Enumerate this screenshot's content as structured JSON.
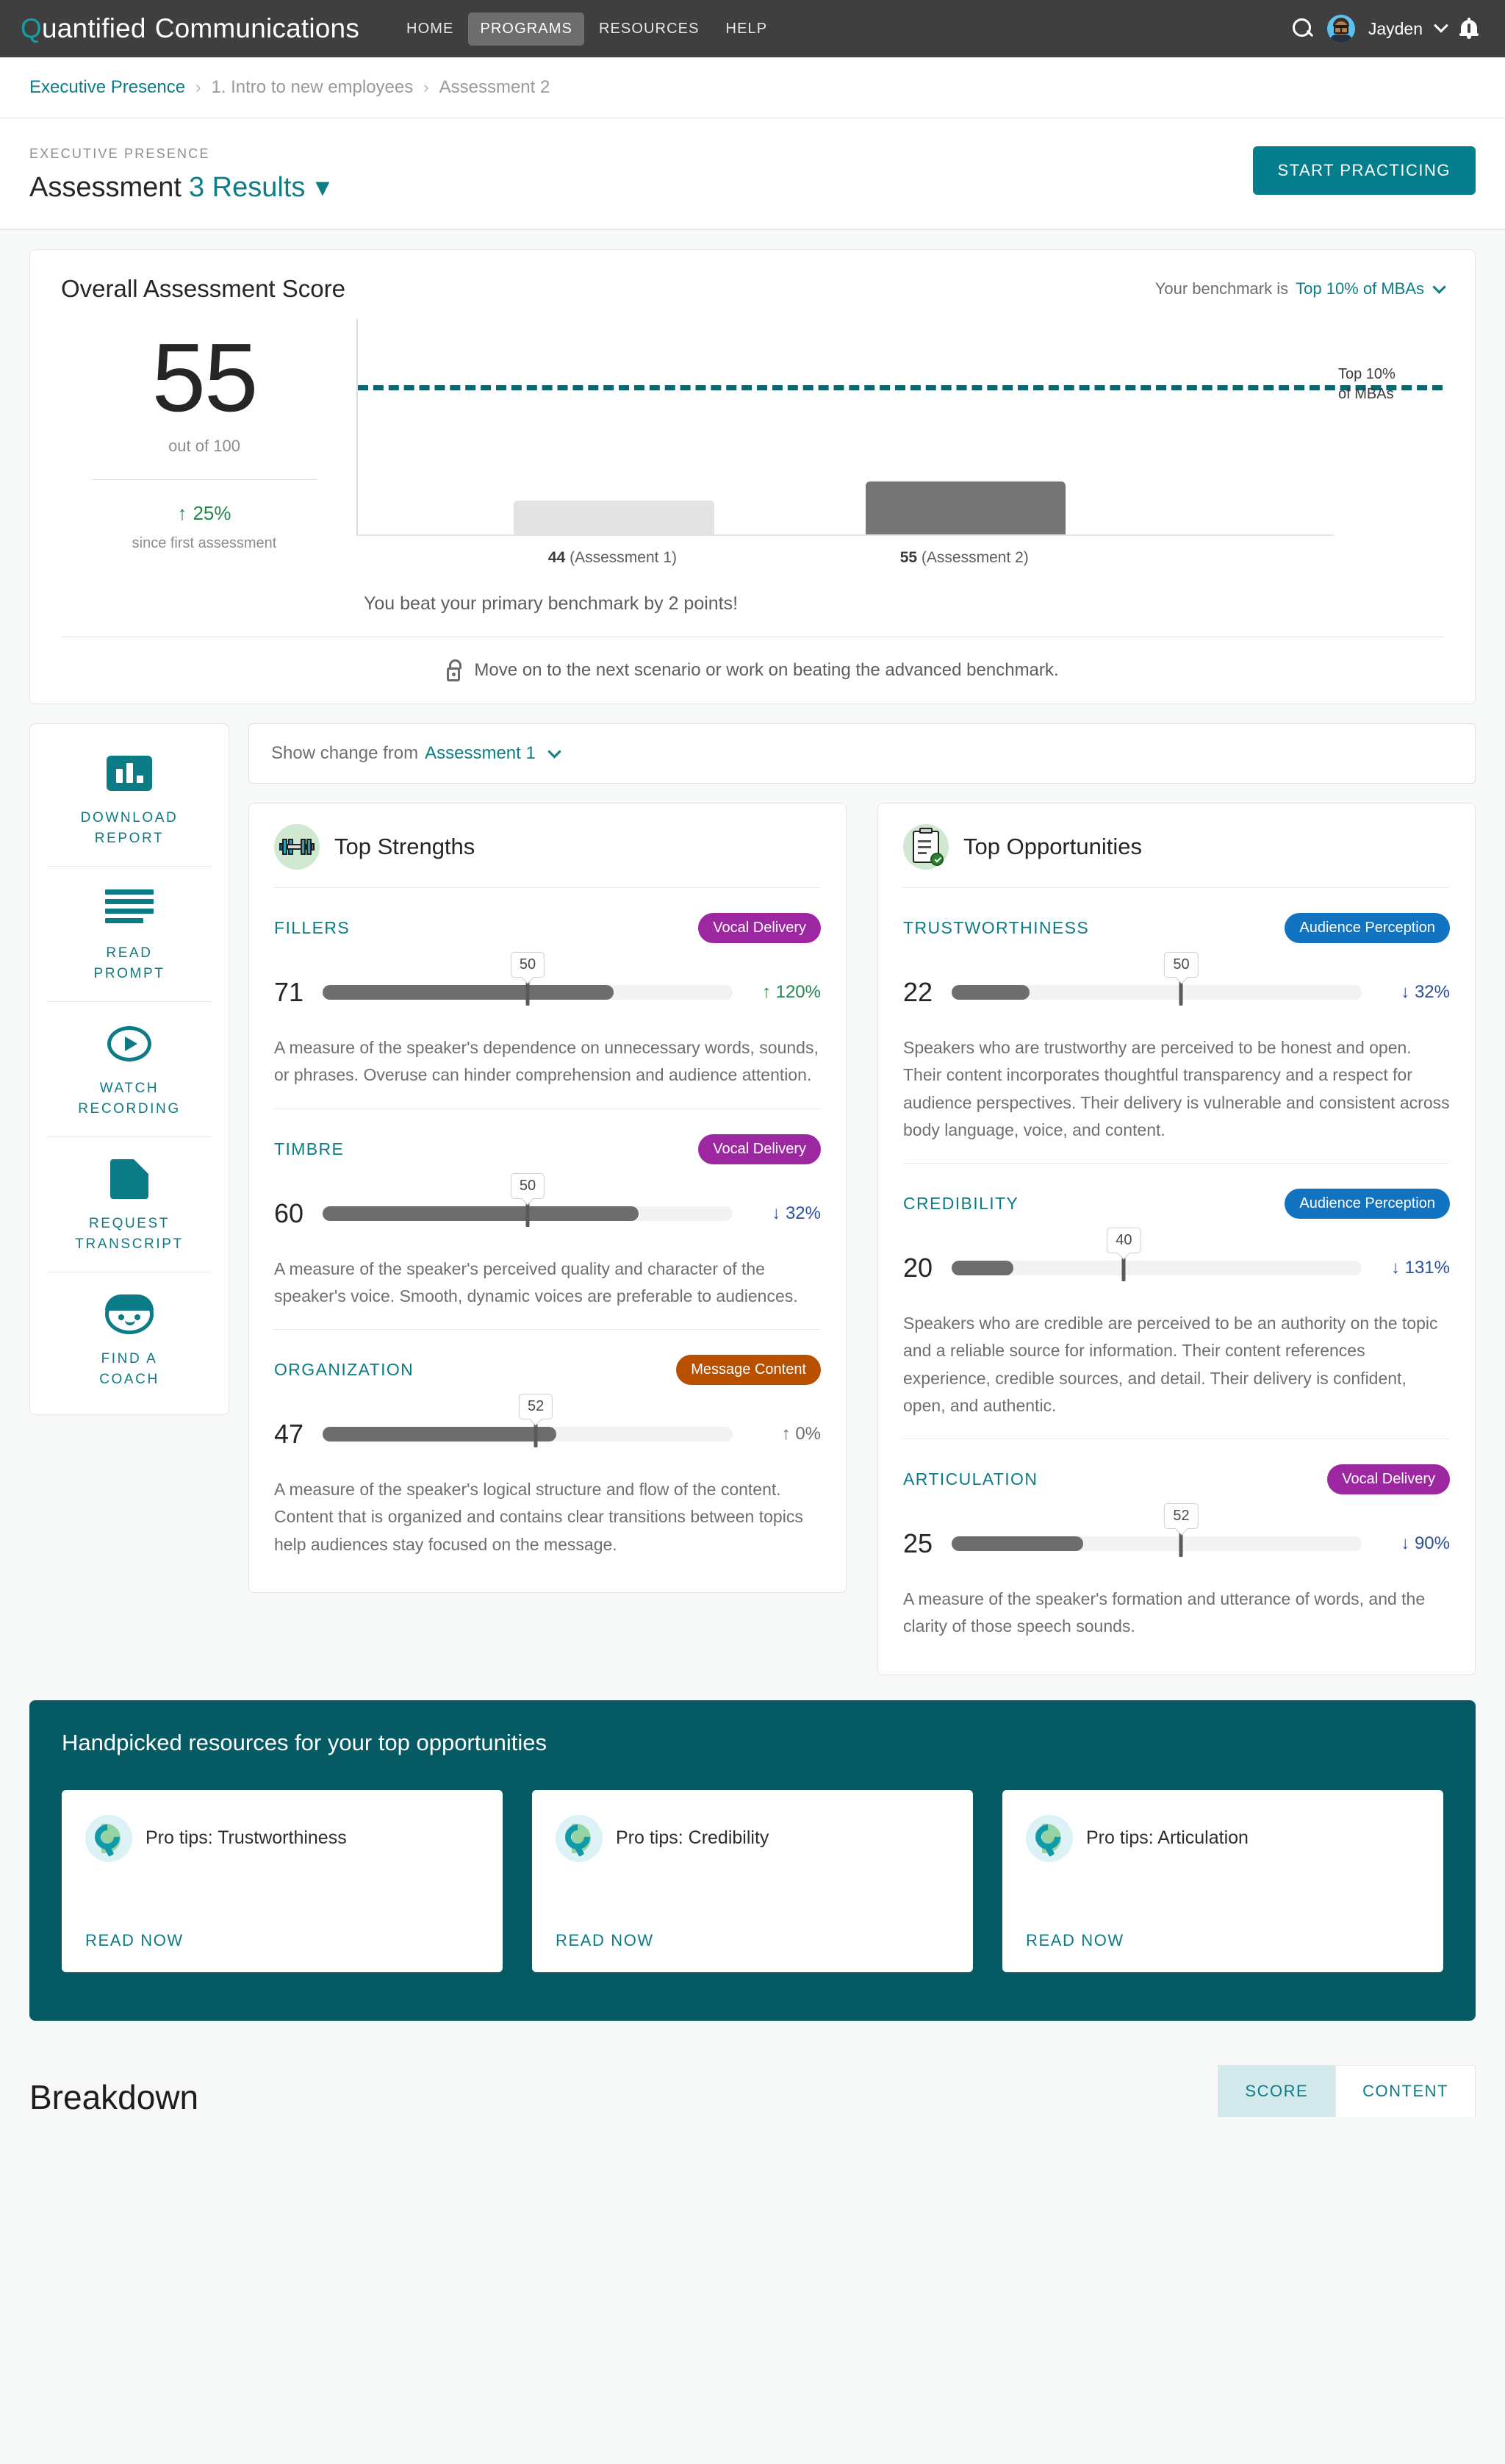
{
  "nav": {
    "brand_q": "Q",
    "brand_rest": "uantified",
    "brand_second": "Communications",
    "links": [
      {
        "label": "HOME",
        "active": false
      },
      {
        "label": "PROGRAMS",
        "active": true
      },
      {
        "label": "RESOURCES",
        "active": false
      },
      {
        "label": "HELP",
        "active": false
      }
    ],
    "username": "Jayden"
  },
  "breadcrumb": {
    "items": [
      "Executive Presence",
      "1. Intro to new employees",
      "Assessment 2"
    ],
    "separator": "›"
  },
  "title_bar": {
    "eyebrow": "EXECUTIVE PRESENCE",
    "title_main": "Assessment",
    "title_accent": "3 Results",
    "cta": "START PRACTICING"
  },
  "score_card": {
    "heading": "Overall Assessment Score",
    "benchmark_prefix": "Your benchmark is",
    "benchmark_value": "Top 10% of MBAs",
    "score": "55",
    "out_of": "out of 100",
    "delta_arrow": "↑",
    "delta": "25%",
    "delta_caption": "since first assessment",
    "benchmark_line_label_1": "Top 10%",
    "benchmark_line_label_2": "of MBAs",
    "beat_message": "You beat your primary benchmark by 2 points!",
    "unlock_message": "Move on to the next scenario or work on beating the advanced benchmark."
  },
  "chart_data": {
    "type": "bar",
    "title": "Overall Assessment Score",
    "categories": [
      "44 (Assessment 1)",
      "55 (Assessment 2)"
    ],
    "values": [
      44,
      55
    ],
    "bar_labels": [
      {
        "score": "44",
        "name": "(Assessment 1)"
      },
      {
        "score": "55",
        "name": "(Assessment 2)"
      }
    ],
    "reference_line": {
      "label": "Top 10% of MBAs",
      "value": 53
    },
    "ylim": [
      0,
      100
    ],
    "xlabel": "",
    "ylabel": "",
    "grid": false,
    "legend": "none",
    "colors": {
      "bar_previous": "#e3e3e3",
      "bar_current": "#757575",
      "reference": "#0b6670"
    }
  },
  "sidebar": {
    "items": [
      {
        "label_line1": "DOWNLOAD",
        "label_line2": "REPORT",
        "icon": "bar-chart-icon"
      },
      {
        "label_line1": "READ",
        "label_line2": "PROMPT",
        "icon": "text-lines-icon"
      },
      {
        "label_line1": "WATCH",
        "label_line2": "RECORDING",
        "icon": "play-circle-icon"
      },
      {
        "label_line1": "REQUEST",
        "label_line2": "TRANSCRIPT",
        "icon": "document-icon"
      },
      {
        "label_line1": "FIND A",
        "label_line2": "COACH",
        "icon": "person-face-icon"
      }
    ]
  },
  "show_change": {
    "prefix": "Show change from",
    "value": "Assessment 1"
  },
  "strengths": {
    "title": "Top Strengths",
    "icon": "dumbbell-icon",
    "metrics": [
      {
        "name": "FILLERS",
        "category": "Vocal Delivery",
        "category_type": "vocal",
        "value": "71",
        "value_num": 71,
        "benchmark": "50",
        "benchmark_num": 50,
        "change_arrow": "↑",
        "change": "120%",
        "change_dir": "up",
        "description": "A measure of the speaker's dependence on unnecessary words, sounds, or phrases. Overuse can hinder comprehension and audience attention."
      },
      {
        "name": "TIMBRE",
        "category": "Vocal Delivery",
        "category_type": "vocal",
        "value": "60",
        "value_num": 60,
        "benchmark": "50",
        "benchmark_num": 50,
        "change_arrow": "↓",
        "change": "32%",
        "change_dir": "down",
        "description": "A measure of the speaker's perceived quality and character of the speaker's voice. Smooth, dynamic voices are preferable to audiences."
      },
      {
        "name": "ORGANIZATION",
        "category": "Message Content",
        "category_type": "message",
        "value": "47",
        "value_num": 47,
        "benchmark": "52",
        "benchmark_num": 52,
        "change_arrow": "↑",
        "change": "0%",
        "change_dir": "flat",
        "description": "A measure of the speaker's logical structure and flow of the content. Content that is organized and contains clear transitions between topics help audiences stay focused on the message."
      }
    ]
  },
  "opportunities": {
    "title": "Top Opportunities",
    "icon": "clipboard-check-icon",
    "metrics": [
      {
        "name": "TRUSTWORTHINESS",
        "category": "Audience Perception",
        "category_type": "audience",
        "value": "22",
        "value_num": 22,
        "benchmark": "50",
        "benchmark_num": 50,
        "change_arrow": "↓",
        "change": "32%",
        "change_dir": "down",
        "description": "Speakers who are trustworthy are perceived to be honest and open. Their content incorporates thoughtful transparency and a respect for audience perspectives. Their delivery is vulnerable and consistent across body language, voice, and content."
      },
      {
        "name": "CREDIBILITY",
        "category": "Audience Perception",
        "category_type": "audience",
        "value": "20",
        "value_num": 20,
        "benchmark": "40",
        "benchmark_num": 40,
        "change_arrow": "↓",
        "change": "131%",
        "change_dir": "down",
        "description": "Speakers who are credible are perceived to be an authority on the topic and a reliable source for information. Their content references experience, credible sources, and detail. Their delivery is confident, open, and authentic."
      },
      {
        "name": "ARTICULATION",
        "category": "Vocal Delivery",
        "category_type": "vocal",
        "value": "25",
        "value_num": 25,
        "benchmark": "52",
        "benchmark_num": 52,
        "change_arrow": "↓",
        "change": "90%",
        "change_dir": "down",
        "description": "A measure of the speaker's formation and utterance of words, and the clarity of those speech sounds."
      }
    ]
  },
  "resources": {
    "title": "Handpicked resources for your top opportunities",
    "cards": [
      {
        "name": "Pro tips: Trustworthiness",
        "cta": "READ NOW"
      },
      {
        "name": "Pro tips: Credibility",
        "cta": "READ NOW"
      },
      {
        "name": "Pro tips: Articulation",
        "cta": "READ NOW"
      }
    ]
  },
  "breakdown": {
    "title": "Breakdown",
    "tabs": [
      {
        "label": "SCORE",
        "active": true
      },
      {
        "label": "CONTENT",
        "active": false
      }
    ]
  },
  "colors": {
    "brand_teal": "#0b7b86",
    "dark_teal": "#065a63",
    "nav_bg": "#3f3f3f",
    "positive_green": "#21874b",
    "negative_blue": "#2a4fa0",
    "vocal_purple": "#9c27a0",
    "audience_blue": "#1273c0",
    "message_orange": "#b85000"
  }
}
